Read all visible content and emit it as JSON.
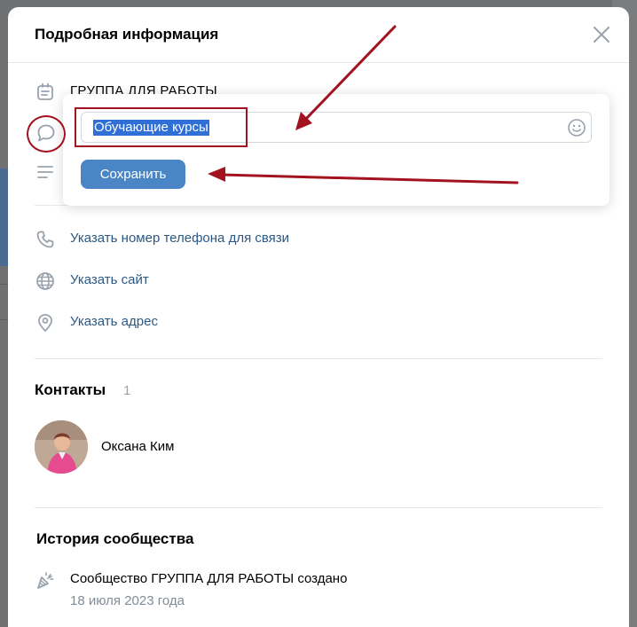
{
  "modal": {
    "title": "Подробная информация"
  },
  "group": {
    "name": "ГРУППА ДЛЯ РАБОТЫ"
  },
  "editor": {
    "value": "Обучающие курсы",
    "save_label": "Сохранить"
  },
  "links": {
    "phone": "Указать номер телефона для связи",
    "site": "Указать сайт",
    "address": "Указать адрес"
  },
  "contacts": {
    "title": "Контакты",
    "count": "1",
    "person_name": "Оксана Ким"
  },
  "history": {
    "title": "История сообщества",
    "event": "Сообщество ГРУППА ДЛЯ РАБОТЫ создано",
    "date": "18 июля 2023 года"
  },
  "icons": {
    "close": "close-icon",
    "group": "group-icon",
    "comment": "comment-icon",
    "description": "lines-icon",
    "phone": "phone-icon",
    "site": "globe-icon",
    "address": "location-pin-icon",
    "history": "party-popper-icon",
    "emoji": "emoji-icon"
  },
  "colors": {
    "link": "#2a5885",
    "button": "#4a86c6",
    "selection": "#2f6fd6",
    "annotation": "#a3121f"
  }
}
